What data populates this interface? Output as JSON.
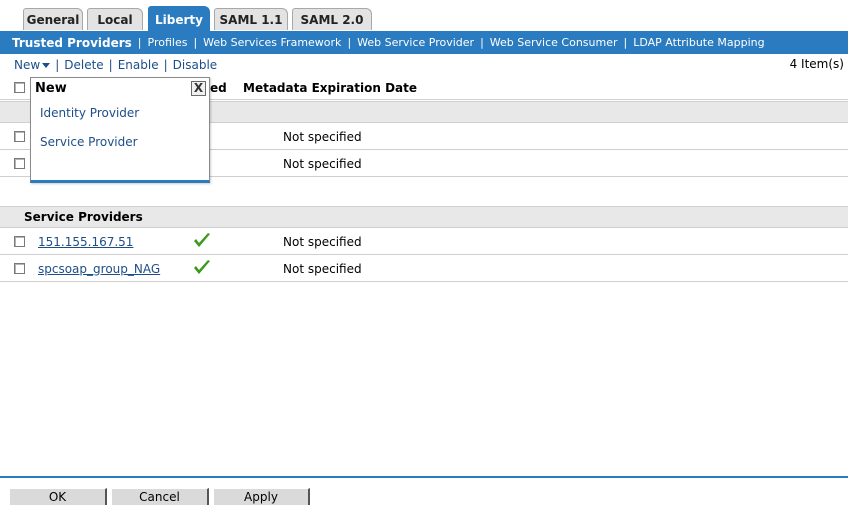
{
  "tabs": [
    {
      "label": "General",
      "active": false
    },
    {
      "label": "Local",
      "active": false
    },
    {
      "label": "Liberty",
      "active": true
    },
    {
      "label": "SAML 1.1",
      "active": false
    },
    {
      "label": "SAML 2.0",
      "active": false
    }
  ],
  "subnav": [
    {
      "label": "Trusted Providers",
      "active": true
    },
    {
      "label": "Profiles"
    },
    {
      "label": "Web Services Framework"
    },
    {
      "label": "Web Service Provider"
    },
    {
      "label": "Web Service Consumer"
    },
    {
      "label": "LDAP Attribute Mapping"
    }
  ],
  "toolbar": {
    "new_label": "New",
    "delete_label": "Delete",
    "enable_label": "Enable",
    "disable_label": "Disable",
    "item_count": "4 Item(s)"
  },
  "table": {
    "columns": {
      "enabled_partial": "ed",
      "metadata": "Metadata Expiration Date"
    },
    "identity_rows": [
      {
        "metadata": "Not specified"
      },
      {
        "metadata": "Not specified"
      }
    ],
    "service_group_label": "Service Providers",
    "service_rows": [
      {
        "name": "151.155.167.51",
        "enabled": true,
        "metadata": "Not specified"
      },
      {
        "name": "spcsoap_group_NAG",
        "enabled": true,
        "metadata": "Not specified"
      }
    ]
  },
  "popup": {
    "title": "New",
    "close_glyph": "X",
    "items": [
      "Identity Provider",
      "Service Provider"
    ]
  },
  "buttons": {
    "ok": "OK",
    "cancel": "Cancel",
    "apply": "Apply"
  },
  "colors": {
    "accent": "#2a7bbf",
    "link": "#1d4e89",
    "check": "#3a9a1a"
  }
}
